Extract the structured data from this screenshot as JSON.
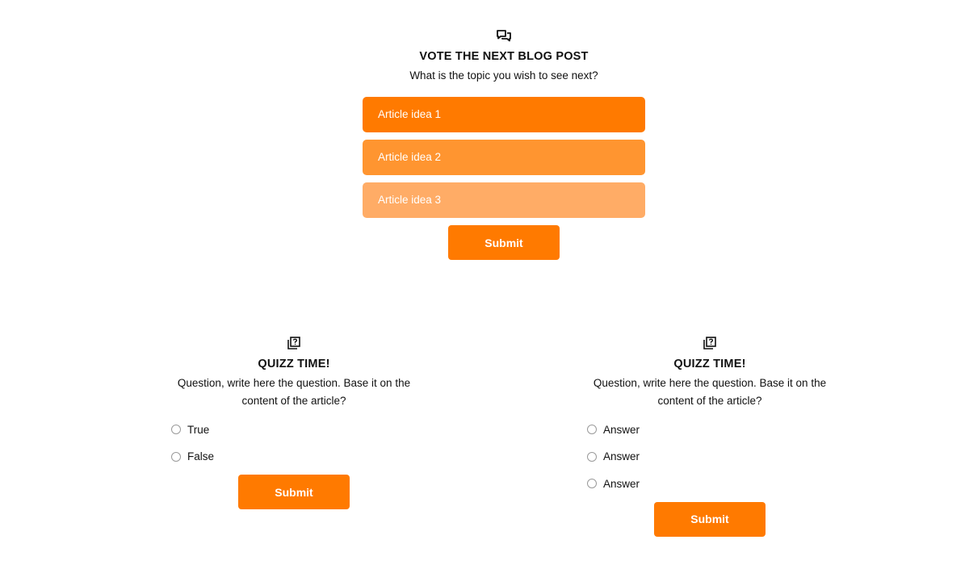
{
  "colors": {
    "accent": "#ff7a00",
    "option_1": "#ff7a00",
    "option_2": "#ff9530",
    "option_3": "#ffac66"
  },
  "poll": {
    "icon": "chat-bubbles-icon",
    "title": "VOTE THE NEXT BLOG POST",
    "subtitle": "What is the topic you wish to see next?",
    "options": [
      {
        "label": "Article idea 1"
      },
      {
        "label": "Article idea 2"
      },
      {
        "label": "Article idea 3"
      }
    ],
    "submit_label": "Submit"
  },
  "quizzes": [
    {
      "icon": "question-cards-icon",
      "title": "QUIZZ TIME!",
      "question_line1": "Question, write here the question. Base it on the",
      "question_line2": "content of the article?",
      "answers": [
        {
          "label": "True"
        },
        {
          "label": "False"
        }
      ],
      "submit_label": "Submit"
    },
    {
      "icon": "question-cards-icon",
      "title": "QUIZZ TIME!",
      "question_line1": "Question, write here the question. Base it on the",
      "question_line2": "content of the article?",
      "answers": [
        {
          "label": "Answer"
        },
        {
          "label": "Answer"
        },
        {
          "label": "Answer"
        }
      ],
      "submit_label": "Submit"
    }
  ]
}
